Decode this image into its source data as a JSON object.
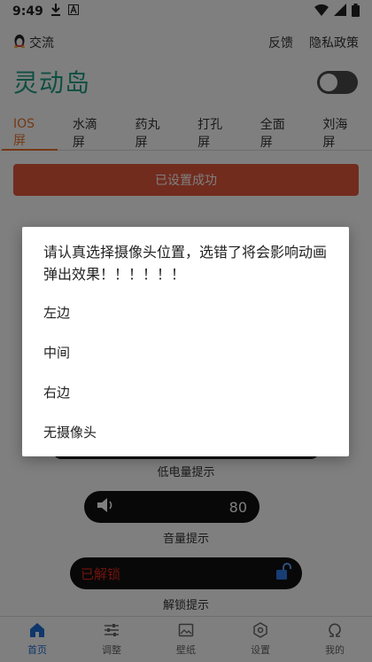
{
  "status_bar": {
    "time": "9:49"
  },
  "topbar": {
    "qq_label": "交流",
    "feedback": "反馈",
    "privacy": "隐私政策"
  },
  "app": {
    "title": "灵动岛"
  },
  "tabs": [
    "IOS屏",
    "水滴屏",
    "药丸屏",
    "打孔屏",
    "全面屏",
    "刘海屏"
  ],
  "success_button": "已设置成功",
  "previews": {
    "low_battery_label": "低电量提示",
    "volume_value": "80",
    "volume_label": "音量提示",
    "unlock_text": "已解锁",
    "unlock_label": "解锁提示"
  },
  "dialog": {
    "message": "请认真选择摄像头位置，选错了将会影响动画弹出效果！！！！！！",
    "options": [
      "左边",
      "中间",
      "右边",
      "无摄像头"
    ]
  },
  "bottom_nav": [
    "首页",
    "调整",
    "壁纸",
    "设置",
    "我的"
  ],
  "colors": {
    "accent": "#e8722a",
    "title": "#1e9e84",
    "success": "#e2583c",
    "nav_active": "#1e6fd9",
    "unlock": "#e0261b"
  }
}
